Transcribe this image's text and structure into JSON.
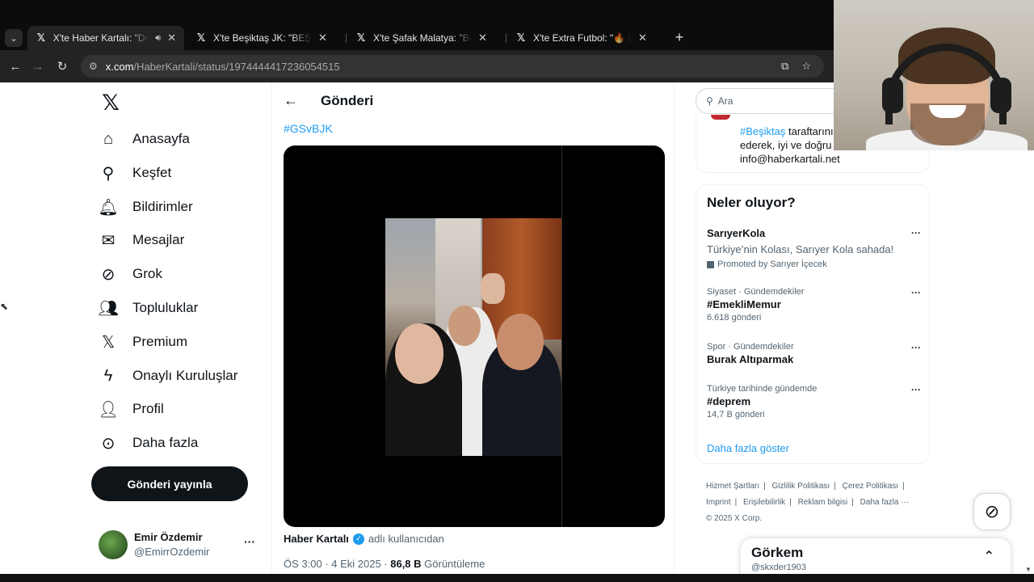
{
  "browser": {
    "tabs": [
      {
        "title": "X'te Haber Kartalı: \"Derbiye",
        "active": true,
        "audio": true
      },
      {
        "title": "X'te Beşiktaş JK: \"BEŞİKTAŞ XI",
        "active": false
      },
      {
        "title": "X'te Şafak Malatya: \"Beşiktaş ta",
        "active": false
      },
      {
        "title": "X'te Extra Futbol: \"🔥 Dev derb",
        "active": false
      }
    ],
    "tab_close": "✕",
    "new_tab": "+",
    "url_domain": "x.com",
    "url_path": "/HaberKartali/status/1974444417236054515"
  },
  "sidebar": {
    "items": [
      {
        "label": "Anasayfa",
        "icon": "home-icon",
        "glyph": "⌂"
      },
      {
        "label": "Keşfet",
        "icon": "search-icon",
        "glyph": "⚲"
      },
      {
        "label": "Bildirimler",
        "icon": "bell-icon",
        "glyph": "🔔︎"
      },
      {
        "label": "Mesajlar",
        "icon": "envelope-icon",
        "glyph": "✉"
      },
      {
        "label": "Grok",
        "icon": "grok-icon",
        "glyph": "⊘"
      },
      {
        "label": "Topluluklar",
        "icon": "communities-icon",
        "glyph": "👥︎"
      },
      {
        "label": "Premium",
        "icon": "x-premium-icon",
        "glyph": "𝕏"
      },
      {
        "label": "Onaylı Kuruluşlar",
        "icon": "lightning-icon",
        "glyph": "ϟ"
      },
      {
        "label": "Profil",
        "icon": "person-icon",
        "glyph": "👤︎"
      },
      {
        "label": "Daha fazla",
        "icon": "more-circle-icon",
        "glyph": "⊙"
      }
    ],
    "post_button": "Gönderi yayınla",
    "account": {
      "name": "Emir Özdemir",
      "handle": "@EmirrOzdemir",
      "more": "···"
    }
  },
  "main": {
    "title": "Gönderi",
    "hashtag": "#GSvBJK",
    "author_name": "Haber Kartalı",
    "author_suffix": "adlı kullanıcıdan",
    "time": "ÖS 3:00 · 4 Eki 2025 · ",
    "views": "86,8 B",
    "views_label": " Görüntüleme"
  },
  "right": {
    "search_placeholder": "Ara",
    "bio": {
      "link_text": "#Beşiktaş",
      "line1_rest": " taraftarını",
      "line2": "ederek, iyi ve doğru h",
      "line3": "info@haberkartali.net"
    },
    "trends_title": "Neler oluyor?",
    "promoted": {
      "name": "SarıyerKola",
      "desc": "Türkiye’nin Kolası, Sarıyer Kola sahada!",
      "by": "Promoted by Sarıyer İçecek"
    },
    "trends": [
      {
        "context": "Siyaset · Gündemdekiler",
        "name": "#EmekliMemur",
        "count": "6.618 gönderi"
      },
      {
        "context": "Spor · Gündemdekiler",
        "name": "Burak Altıparmak",
        "count": ""
      },
      {
        "context": "Türkiye tarihinde gündemde",
        "name": "#deprem",
        "count": "14,7 B gönderi"
      }
    ],
    "show_more": "Daha fazla göster",
    "footer": [
      "Hizmet Şartları",
      "|",
      "Gizlilik Politikası",
      "|",
      "Çerez Politikası",
      "|",
      "Imprint",
      "|",
      "Erişilebilirlik",
      "|",
      "Reklam bilgisi",
      "|",
      "Daha fazla ···",
      "© 2025 X Corp."
    ],
    "dm": {
      "title": "Görkem",
      "handle": "@skxder1903"
    }
  }
}
